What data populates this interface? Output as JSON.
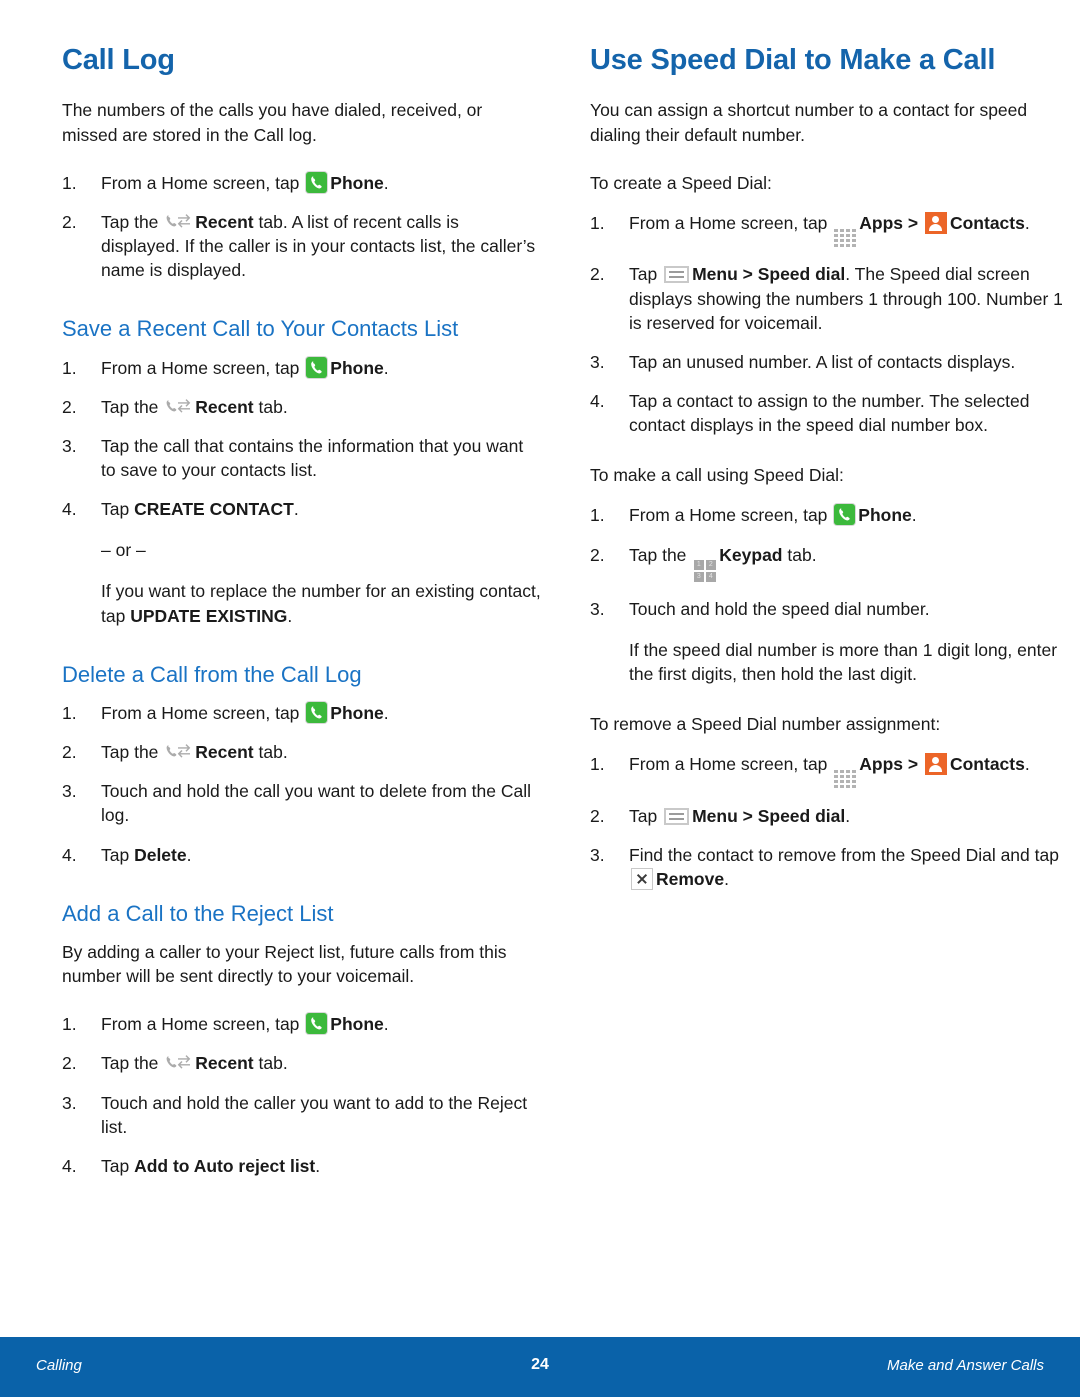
{
  "colors": {
    "heading_blue": "#1464ab",
    "subheading_blue": "#1a73c4",
    "footer_blue": "#0a62a9",
    "phone_icon_green": "#3cb93c",
    "contacts_icon_orange": "#ec6528"
  },
  "left_column": {
    "title": "Call Log",
    "intro": "The numbers of the calls you have dialed, received, or missed are stored in the Call log.",
    "steps": [
      {
        "num": "1.",
        "pre": "From a Home screen, tap ",
        "icon": "phone-icon",
        "bold": "Phone",
        "post": "."
      },
      {
        "num": "2.",
        "pre": "Tap the ",
        "icon": "recent-icon",
        "bold": "Recent",
        "post": " tab. A list of recent calls is displayed. If the caller is in your contacts list, the caller’s name is displayed."
      }
    ],
    "section_save": {
      "title": "Save a Recent Call to Your Contacts List",
      "steps": [
        {
          "num": "1.",
          "pre": "From a Home screen, tap ",
          "icon": "phone-icon",
          "bold": "Phone",
          "post": "."
        },
        {
          "num": "2.",
          "pre": "Tap the ",
          "icon": "recent-icon",
          "bold": "Recent",
          "post": " tab."
        },
        {
          "num": "3.",
          "pre": "Tap the call that contains the information that you want to save to your contacts list.",
          "icon": "",
          "bold": "",
          "post": ""
        },
        {
          "num": "4.",
          "pre": "Tap ",
          "icon": "",
          "bold": "CREATE CONTACT",
          "post": "."
        }
      ],
      "or_text": "– or –",
      "alt_pre": "If you want to replace the number for an existing contact, tap ",
      "alt_bold": "UPDATE EXISTING",
      "alt_post": "."
    },
    "section_delete": {
      "title": "Delete a Call from the Call Log",
      "steps": [
        {
          "num": "1.",
          "pre": "From a Home screen, tap ",
          "icon": "phone-icon",
          "bold": "Phone",
          "post": "."
        },
        {
          "num": "2.",
          "pre": "Tap the ",
          "icon": "recent-icon",
          "bold": "Recent",
          "post": " tab."
        },
        {
          "num": "3.",
          "pre": "Touch and hold the call you want to delete from the Call log.",
          "icon": "",
          "bold": "",
          "post": ""
        },
        {
          "num": "4.",
          "pre": "Tap ",
          "icon": "",
          "bold": "Delete",
          "post": "."
        }
      ]
    },
    "section_reject": {
      "title": "Add a Call to the Reject List",
      "intro": "By adding a caller to your Reject list, future calls from this number will be sent directly to your voicemail.",
      "steps": [
        {
          "num": "1.",
          "pre": "From a Home screen, tap ",
          "icon": "phone-icon",
          "bold": "Phone",
          "post": "."
        },
        {
          "num": "2.",
          "pre": "Tap the ",
          "icon": "recent-icon",
          "bold": "Recent",
          "post": " tab."
        },
        {
          "num": "3.",
          "pre": "Touch and hold the caller you want to add to the Reject list.",
          "icon": "",
          "bold": "",
          "post": ""
        },
        {
          "num": "4.",
          "pre": "Tap ",
          "icon": "",
          "bold": "Add to Auto reject list",
          "post": "."
        }
      ]
    }
  },
  "right_column": {
    "title": "Use Speed Dial to Make a Call",
    "intro": "You can assign a shortcut number to a contact for speed dialing their default number.",
    "create": {
      "lead": "To create a Speed Dial:",
      "step1": {
        "num": "1.",
        "pre": "From a Home screen, tap ",
        "apps_icon": "apps-icon",
        "apps_bold": "Apps",
        "sep": " > ",
        "contacts_icon": "contacts-icon",
        "contacts_bold": "Contacts",
        "post": "."
      },
      "step2": {
        "num": "2.",
        "pre": "Tap ",
        "menu_icon": "menu-icon",
        "bold1": "Menu > Speed dial",
        "post": ". The Speed dial screen displays showing the numbers 1 through 100. Number 1 is reserved for voicemail."
      },
      "step3": {
        "num": "3.",
        "text": "Tap an unused number. A list of contacts displays."
      },
      "step4": {
        "num": "4.",
        "text": "Tap a contact to assign to the number. The selected contact displays in the speed dial number box."
      }
    },
    "make_call": {
      "lead": "To make a call using Speed Dial:",
      "step1": {
        "num": "1.",
        "pre": "From a Home screen, tap ",
        "icon": "phone-icon",
        "bold": "Phone",
        "post": "."
      },
      "step2": {
        "num": "2.",
        "pre": "Tap the ",
        "icon": "keypad-icon",
        "bold": "Keypad",
        "post": " tab."
      },
      "step3": {
        "num": "3.",
        "text": "Touch and hold the speed dial number."
      },
      "note": "If the speed dial number is more than 1 digit long, enter the first digits, then hold the last digit."
    },
    "remove": {
      "lead": "To remove a Speed Dial number assignment:",
      "step1": {
        "num": "1.",
        "pre": "From a Home screen, tap ",
        "apps_icon": "apps-icon",
        "apps_bold": "Apps",
        "sep": " > ",
        "contacts_icon": "contacts-icon",
        "contacts_bold": "Contacts",
        "post": "."
      },
      "step2": {
        "num": "2.",
        "pre": "Tap ",
        "menu_icon": "menu-icon",
        "bold1": "Menu > Speed dial",
        "post": "."
      },
      "step3": {
        "num": "3.",
        "pre": "Find the contact to remove from the Speed Dial and tap ",
        "icon": "remove-icon",
        "bold": "Remove",
        "post": "."
      }
    }
  },
  "footer": {
    "left": "Calling",
    "page_number": "24",
    "right": "Make and Answer Calls"
  },
  "keypad_digits": [
    "1",
    "2",
    "3",
    "4"
  ]
}
